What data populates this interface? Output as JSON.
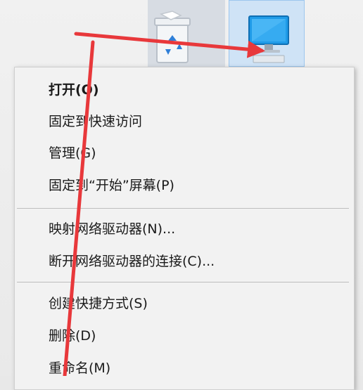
{
  "desktop": {
    "icons": [
      {
        "name": "recycle-bin-icon"
      },
      {
        "name": "this-pc-icon",
        "selected": true
      }
    ]
  },
  "context_menu": {
    "items": [
      {
        "label": "打开(O)",
        "bold": true
      },
      {
        "label": "固定到快速访问"
      },
      {
        "label": "管理(G)"
      },
      {
        "label": "固定到“开始”屏幕(P)"
      },
      {
        "label": "映射网络驱动器(N)..."
      },
      {
        "label": "断开网络驱动器的连接(C)..."
      },
      {
        "label": "创建快捷方式(S)"
      },
      {
        "label": "删除(D)"
      },
      {
        "label": "重命名(M)"
      }
    ]
  },
  "colors": {
    "arrow": "#e8383b",
    "selection": "#cfe3f6"
  }
}
